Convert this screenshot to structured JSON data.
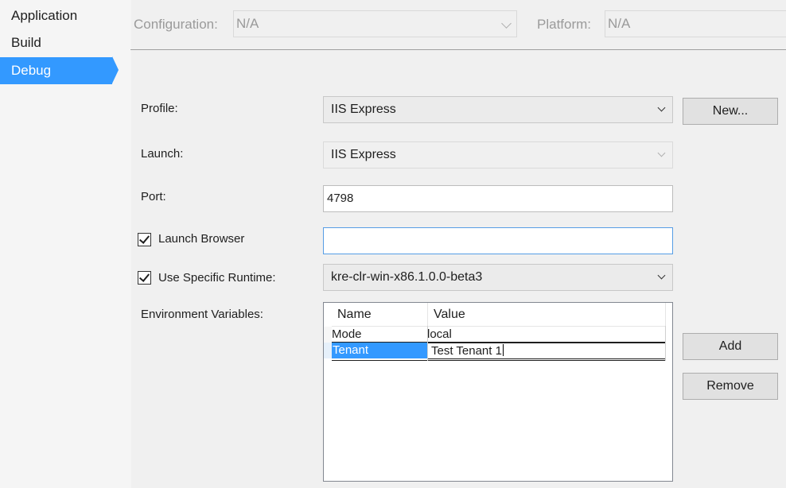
{
  "nav": {
    "items": [
      {
        "label": "Application"
      },
      {
        "label": "Build"
      },
      {
        "label": "Debug"
      }
    ],
    "active": "Debug"
  },
  "config_bar": {
    "configuration_label": "Configuration:",
    "configuration_value": "N/A",
    "platform_label": "Platform:",
    "platform_value": "N/A"
  },
  "form": {
    "profile_label": "Profile:",
    "profile_value": "IIS Express",
    "new_button": "New...",
    "launch_label": "Launch:",
    "launch_value": "IIS Express",
    "port_label": "Port:",
    "port_value": "4798",
    "launch_browser_label": "Launch Browser",
    "launch_browser_checked": true,
    "launch_browser_value": "",
    "runtime_label": "Use Specific Runtime:",
    "runtime_checked": true,
    "runtime_value": "kre-clr-win-x86.1.0.0-beta3",
    "env_label": "Environment Variables:",
    "add_button": "Add",
    "remove_button": "Remove"
  },
  "env_grid": {
    "columns": [
      "Name",
      "Value"
    ],
    "rows": [
      {
        "name": "Mode",
        "value": "local"
      },
      {
        "name": "Tenant",
        "value": "Test Tenant 1"
      }
    ],
    "selected_row": 1
  },
  "colors": {
    "accent": "#3399ff",
    "background": "#f0f0f0",
    "focus_border": "#569de5"
  }
}
